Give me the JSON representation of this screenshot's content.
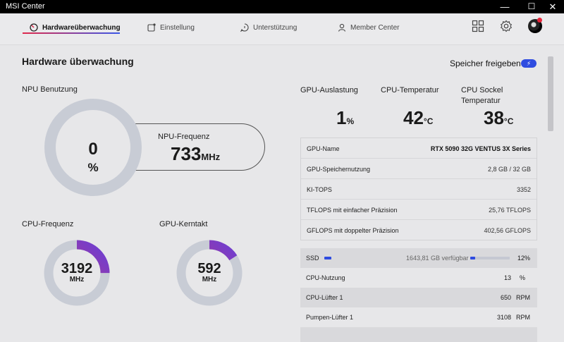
{
  "window": {
    "title": "MSI Center",
    "minimize": "—",
    "maximize": "☐",
    "close": "✕"
  },
  "nav": {
    "tabs": [
      {
        "label": "Hardwareüberwachung",
        "icon": "gauge-icon",
        "active": true
      },
      {
        "label": "Einstellung",
        "icon": "settings-window-icon"
      },
      {
        "label": "Unterstützung",
        "icon": "support-chat-icon"
      },
      {
        "label": "Member Center",
        "icon": "user-icon"
      }
    ]
  },
  "page": {
    "title": "Hardware überwachung",
    "release_label": "Speicher freigeben"
  },
  "npu": {
    "label": "NPU Benutzung",
    "value": "0",
    "unit": "%",
    "usage": 0,
    "freq_label": "NPU-Frequenz",
    "freq_value": "733",
    "freq_unit": "MHz"
  },
  "cpu_freq": {
    "label": "CPU-Frequenz",
    "value": "3192",
    "unit": "MHz",
    "level": 0.25
  },
  "gpu_clock": {
    "label": "GPU-Kerntakt",
    "value": "592",
    "unit": "MHz",
    "level": 0.16
  },
  "stats": {
    "gpu_load": {
      "label": "GPU-Auslastung",
      "value": "1",
      "unit": "%"
    },
    "cpu_temp": {
      "label": "CPU-Temperatur",
      "value": "42",
      "unit": "°C"
    },
    "cpu_socket": {
      "label1": "CPU Sockel",
      "label2": "Temperatur",
      "value": "38",
      "unit": "°C"
    }
  },
  "gpu_info": [
    {
      "key": "GPU-Name",
      "value": "RTX 5090 32G VENTUS 3X Series"
    },
    {
      "key": "GPU-Speichernutzung",
      "value": "2,8 GB / 32 GB"
    },
    {
      "key": "KI-TOPS",
      "value": "3352"
    },
    {
      "key": "TFLOPS mit einfacher Präzision",
      "value": "25,76 TFLOPS"
    },
    {
      "key": "GFLOPS mit doppelter Präzision",
      "value": "402,56 GFLOPS"
    }
  ],
  "monitor": {
    "ssd": {
      "label": "SSD",
      "free": "1643,81 GB verfügbar",
      "percent": "12%",
      "level": 0.12
    },
    "rows": [
      {
        "label": "CPU-Nutzung",
        "value": "13",
        "unit": "%"
      },
      {
        "label": "CPU-Lüfter 1",
        "value": "650",
        "unit": "RPM"
      },
      {
        "label": "Pumpen-Lüfter 1",
        "value": "3108",
        "unit": "RPM"
      }
    ]
  },
  "colors": {
    "accent": "#2f4ce0",
    "gauge_track": "#c8ccd5",
    "gauge_start": "#d3326a",
    "gauge_end": "#6a3fd6"
  }
}
